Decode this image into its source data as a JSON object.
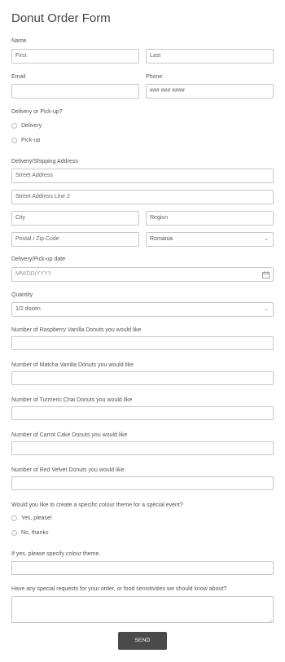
{
  "form": {
    "title": "Donut Order Form",
    "name_label": "Name",
    "first_placeholder": "First",
    "last_placeholder": "Last",
    "email_label": "Email",
    "phone_label": "Phone",
    "phone_placeholder": "### ### ####",
    "delivery_label": "Delivery or Pick-up?",
    "delivery_options": [
      "Delivery",
      "Pick-up"
    ],
    "address_label": "Delivery/Shipping Address",
    "street_placeholder": "Street Address",
    "street2_placeholder": "Street Address Line 2",
    "city_placeholder": "City",
    "region_placeholder": "Region",
    "postal_placeholder": "Postal / Zip Code",
    "country_value": "Romania",
    "date_label": "Delivery/Pick-up date",
    "date_placeholder": "MM/DD/YYYY",
    "quantity_label": "Quantity",
    "quantity_value": "1/2 dozen",
    "raspberry_label": "Number of Raspberry Vanilla Donuts you would like",
    "matcha_label": "Number of Matcha Vanilla Donuts you would like",
    "turmeric_label": "Number of Turmeric Chai Donuts you would like",
    "carrot_label": "Number of Carrot Cake Donuts you would like",
    "redvelvet_label": "Number of Red Velvet Donuts you would like",
    "theme_question": "Would you like to create a specific colour theme for a special event?",
    "theme_options": [
      "Yes, please!",
      "No, thanks"
    ],
    "theme_specify_label": "If yes, please specify colour theme.",
    "requests_label": "Have any special requests for your order, or food sensitivities we should know about?",
    "send_label": "SEND"
  },
  "icons": {
    "calendar": "calendar-icon",
    "chevron": "chevron-down-icon"
  },
  "colors": {
    "border": "#c8c8c8",
    "button_bg": "#4a4a4a",
    "button_text": "#ffffff",
    "title": "#444444"
  }
}
